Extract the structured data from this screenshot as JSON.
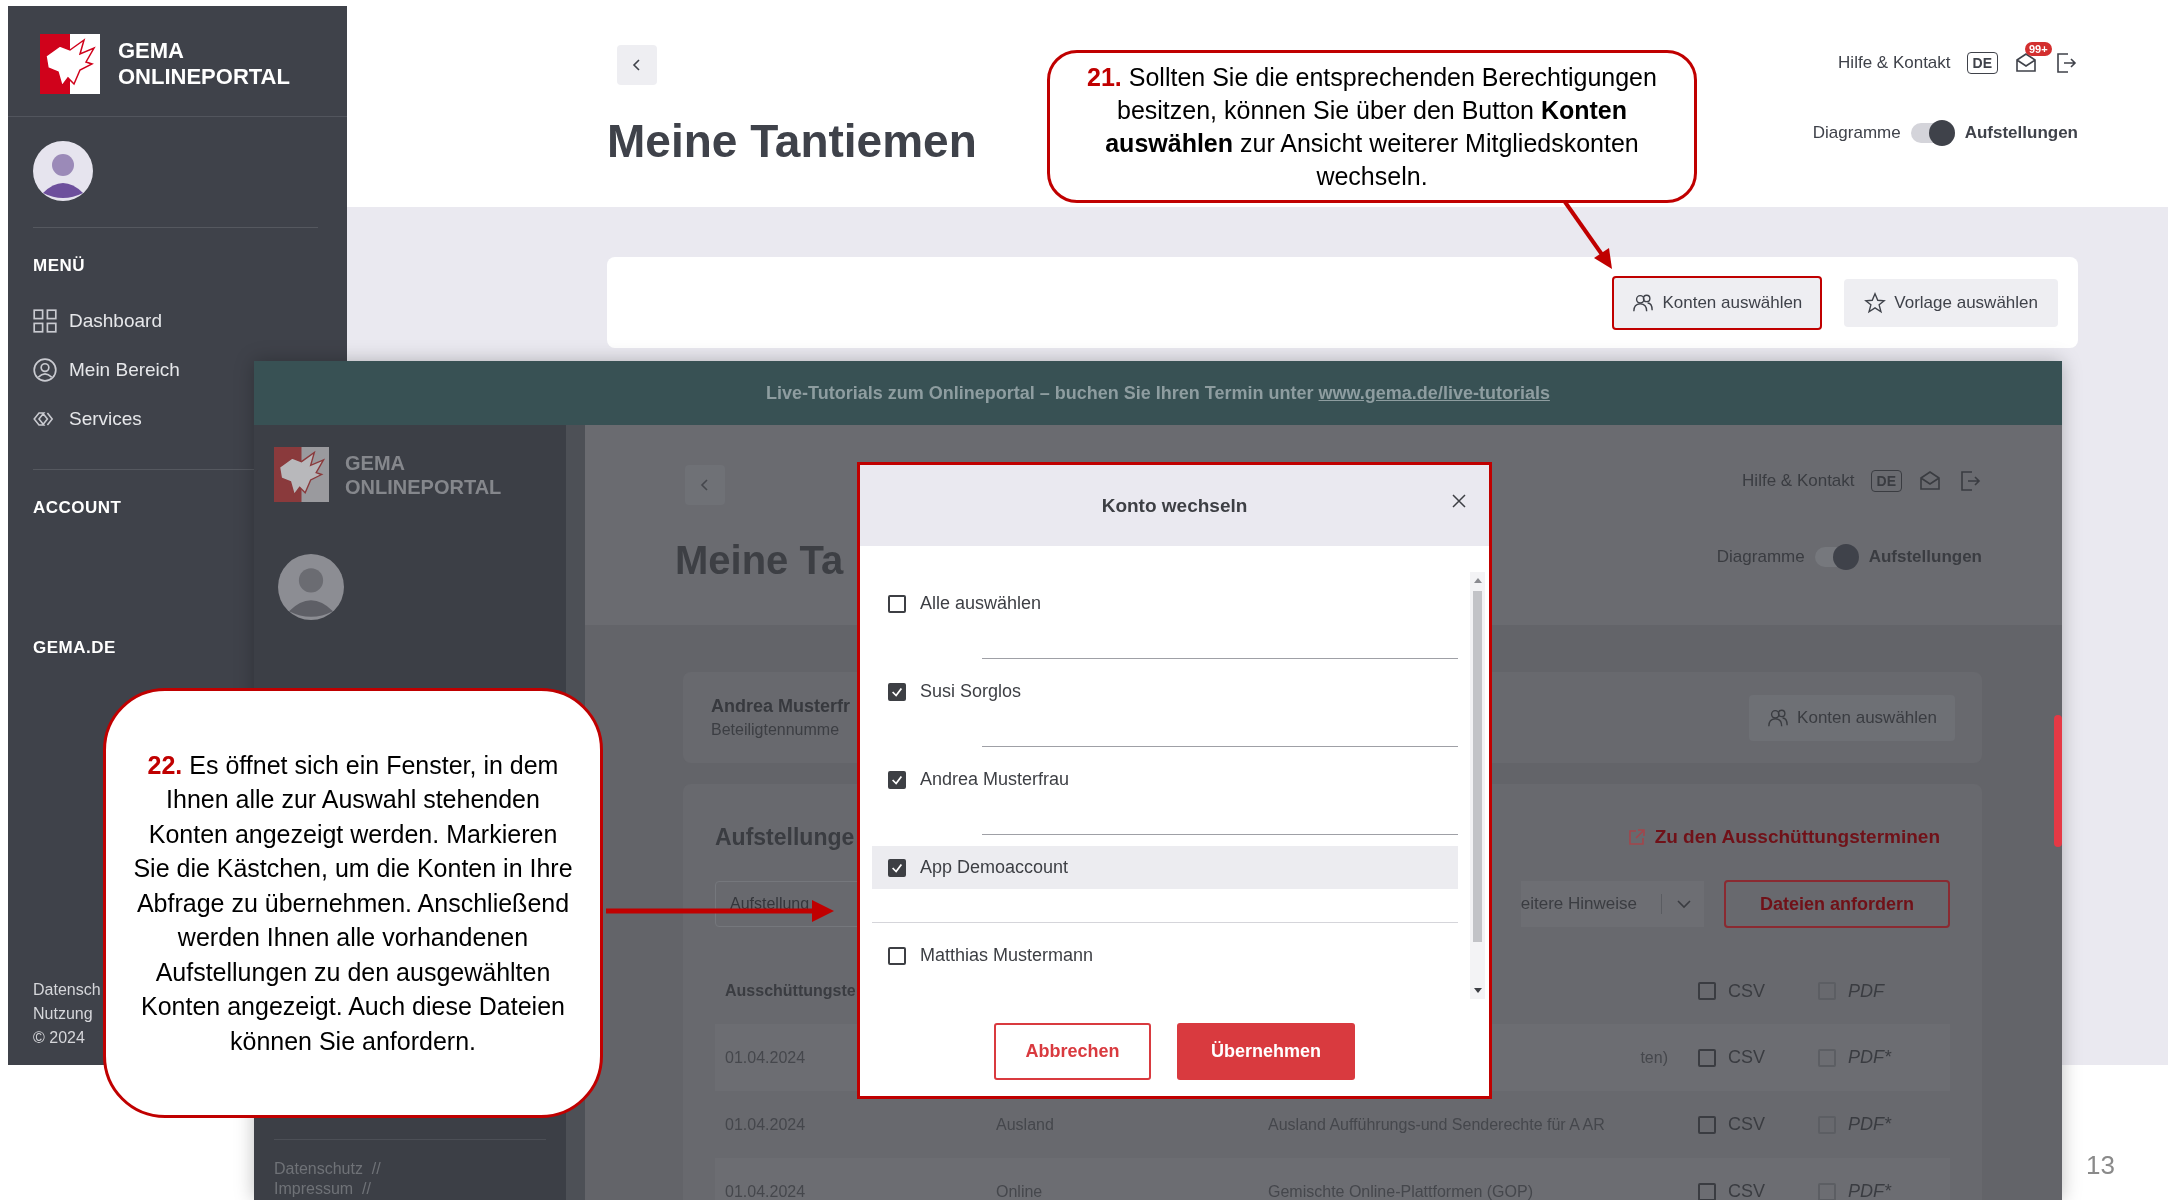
{
  "slide_number": "13",
  "back_screen": {
    "sidebar": {
      "logo_lines": [
        "GEMA",
        "ONLINEPORTAL"
      ],
      "menu_heading": "MENÜ",
      "items": [
        {
          "label": "Dashboard"
        },
        {
          "label": "Mein Bereich"
        },
        {
          "label": "Services"
        }
      ],
      "sections": [
        "ACCOUNT",
        "GEMA.DE"
      ],
      "footer": [
        "Datensch",
        "Nutzung",
        "© 2024"
      ]
    },
    "header": {
      "title": "Meine Tantiemen",
      "help": "Hilfe & Kontakt",
      "language": "DE",
      "notification_count": "99+",
      "toggle": {
        "left": "Diagramme",
        "right": "Aufstellungen",
        "on": true
      }
    },
    "buttons": [
      {
        "label": "Konten auswählen",
        "highlighted": true
      },
      {
        "label": "Vorlage auswählen",
        "highlighted": false
      }
    ]
  },
  "front_screen": {
    "banner": {
      "text": "Live-Tutorials zum Onlineportal – buchen Sie Ihren Termin unter",
      "link": "www.gema.de/live-tutorials"
    },
    "sidebar": {
      "logo_lines": [
        "GEMA",
        "ONLINEPORTAL"
      ],
      "footer": [
        "Datenschutz  //",
        "Impressum  //"
      ]
    },
    "header": {
      "title": "Meine Ta",
      "help": "Hilfe & Kontakt",
      "language": "DE",
      "toggle": {
        "left": "Diagramme",
        "right": "Aufstellungen",
        "on": true
      }
    },
    "account_card": {
      "name": "Andrea Musterfr",
      "number": "Beteiligtennumme",
      "button": "Konten auswählen"
    },
    "statements": {
      "title": "Aufstellunge",
      "link": "Zu den Ausschüttungsterminen",
      "filter": "Aufstellung",
      "notes_filter": "eitere Hinweise",
      "request_button": "Dateien anfordern",
      "table": {
        "column": "Ausschüttungste",
        "csv": {
          "label": "CSV",
          "checked": false,
          "disabled": false
        },
        "pdf": {
          "label": "PDF",
          "checked": false,
          "disabled": true
        },
        "rows": [
          {
            "date": "01.04.2024",
            "description": "ten)",
            "csv": {
              "label": "CSV",
              "checked": false,
              "disabled": false
            },
            "pdf": {
              "label": "PDF*",
              "checked": false,
              "disabled": true
            }
          },
          {
            "date": "01.04.2024",
            "category": "Ausland",
            "description": "Ausland Aufführungs-und Senderechte für A AR",
            "csv": {
              "label": "CSV",
              "checked": false,
              "disabled": false
            },
            "pdf": {
              "label": "PDF*",
              "checked": false,
              "disabled": true
            }
          },
          {
            "date": "01.04.2024",
            "category": "Online",
            "description": "Gemischte Online-Plattformen (GOP)",
            "csv": {
              "label": "CSV",
              "checked": false,
              "disabled": false
            },
            "pdf": {
              "label": "PDF*",
              "checked": false,
              "disabled": true
            }
          }
        ]
      }
    }
  },
  "modal": {
    "title": "Konto wechseln",
    "items": [
      {
        "label": "Alle auswählen",
        "checked": false,
        "highlighted": false
      },
      {
        "label": "Susi Sorglos",
        "checked": true,
        "highlighted": false
      },
      {
        "label": "Andrea Musterfrau",
        "checked": true,
        "highlighted": false
      },
      {
        "label": "App Demoaccount",
        "checked": true,
        "highlighted": true
      },
      {
        "label": "Matthias Mustermann",
        "checked": false,
        "highlighted": false
      }
    ],
    "buttons": [
      {
        "label": "Abbrechen",
        "kind": "secondary"
      },
      {
        "label": "Übernehmen",
        "kind": "primary"
      }
    ]
  },
  "callouts": [
    {
      "number": "21.",
      "text": "Sollten Sie die entsprechenden Berechtigungen besitzen, können Sie über den Button **Konten auswählen** zur Ansicht weiterer Mitgliedskonten wechseln."
    },
    {
      "number": "22.",
      "text": "Es öffnet sich ein Fenster, in dem Ihnen alle zur Auswahl stehenden Konten angezeigt werden. Markieren Sie die Kästchen, um die Konten in Ihre Abfrage zu übernehmen. Anschließend werden Ihnen alle vorhandenen Aufstellungen zu den ausgewählten Konten angezeigt. Auch diese Dateien können Sie anfordern."
    }
  ]
}
